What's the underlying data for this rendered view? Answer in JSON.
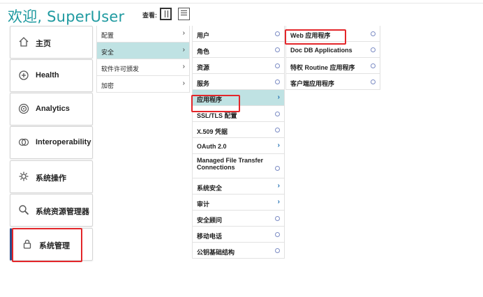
{
  "header": {
    "welcome": "欢迎, SuperUser",
    "view_label": "查看:",
    "view_columns_icon": "columns-view-icon",
    "view_list_icon": "list-view-icon"
  },
  "main_menu": [
    {
      "label": "主页",
      "icon": "home-icon"
    },
    {
      "label": "Health",
      "icon": "health-icon"
    },
    {
      "label": "Analytics",
      "icon": "analytics-icon"
    },
    {
      "label": "Interoperability",
      "icon": "interoperability-icon"
    },
    {
      "label": "系统操作",
      "icon": "gear-icon"
    },
    {
      "label": "系统资源管理器",
      "icon": "search-icon"
    },
    {
      "label": "系统管理",
      "icon": "lock-icon",
      "active": true
    }
  ],
  "column1": [
    {
      "label": "配置"
    },
    {
      "label": "安全",
      "selected": true
    },
    {
      "label": "软件许可颁发"
    },
    {
      "label": "加密"
    }
  ],
  "column2": [
    {
      "label": "用户"
    },
    {
      "label": "角色"
    },
    {
      "label": "资源"
    },
    {
      "label": "服务"
    },
    {
      "label": "应用程序",
      "selected": true
    },
    {
      "label": "SSL/TLS 配置"
    },
    {
      "label": "X.509 凭据"
    },
    {
      "label": "OAuth 2.0"
    },
    {
      "label": "Managed File Transfer Connections"
    },
    {
      "label": "系统安全"
    },
    {
      "label": "审计"
    },
    {
      "label": "安全顾问"
    },
    {
      "label": "移动电话"
    },
    {
      "label": "公钥基础结构"
    }
  ],
  "column3": [
    {
      "label": "Web 应用程序"
    },
    {
      "label": "Doc DB Applications"
    },
    {
      "label": "特权 Routine 应用程序"
    },
    {
      "label": "客户端应用程序"
    }
  ],
  "colors": {
    "accent": "#1f9aa0",
    "selected_bg": "#bfe2e3",
    "active_bar": "#2b4d8c",
    "highlight": "#e3262a"
  }
}
